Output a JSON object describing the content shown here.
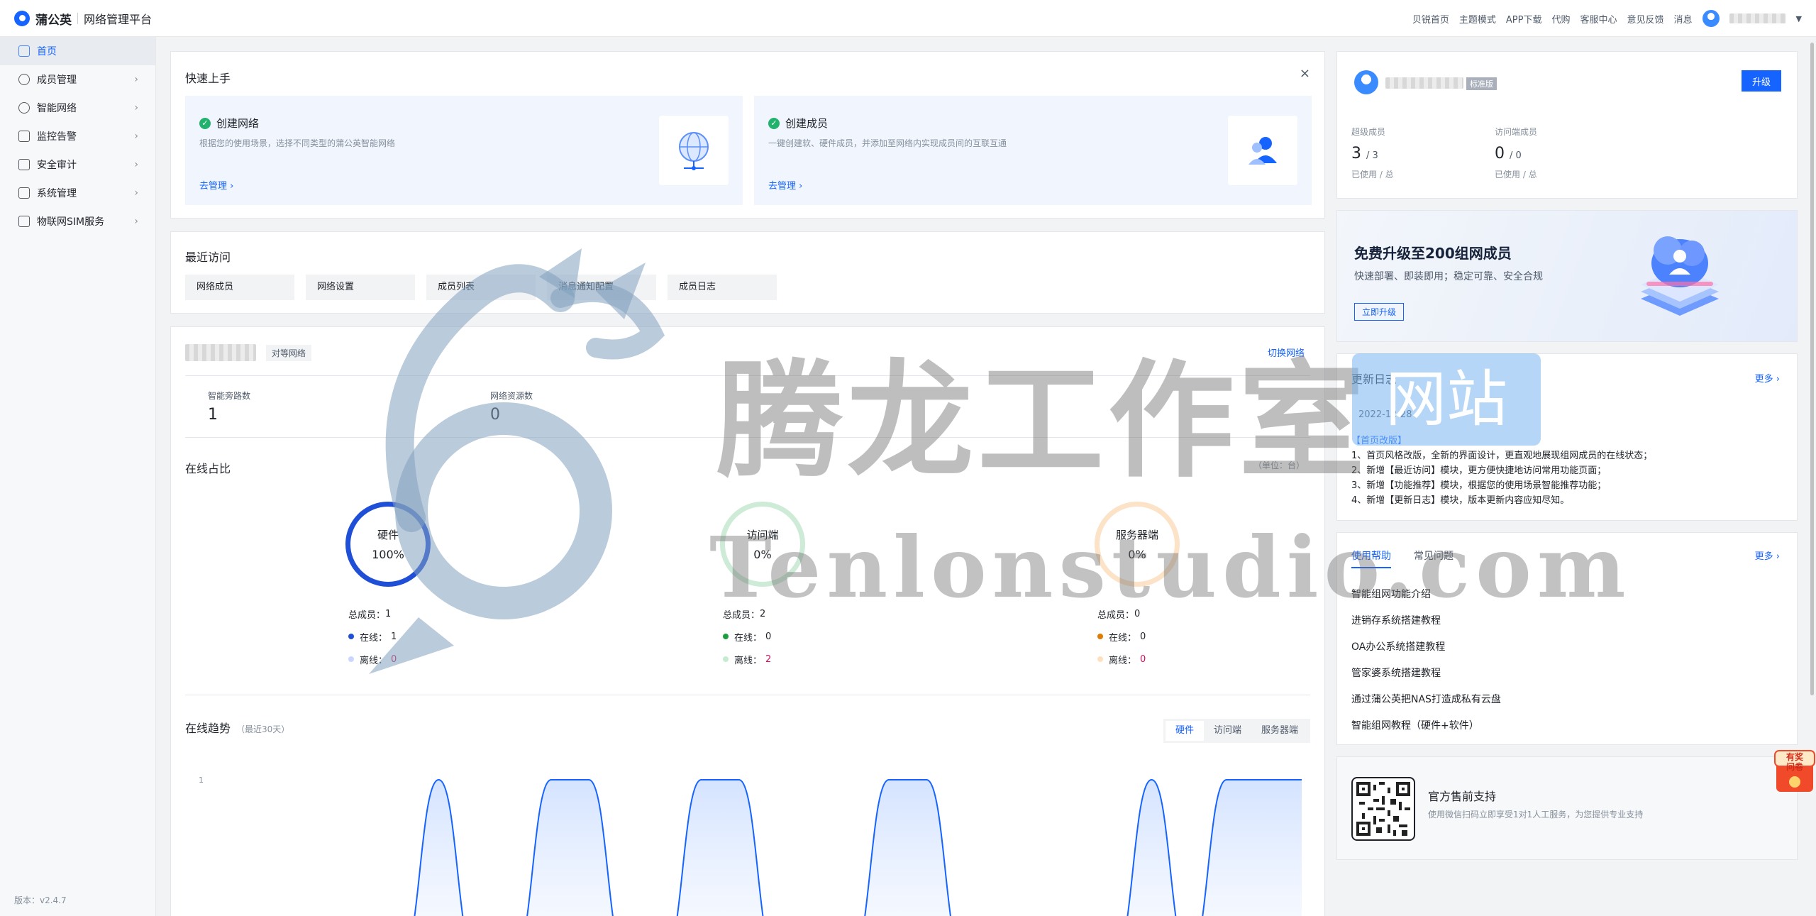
{
  "topbar": {
    "brand_name": "蒲公英",
    "brand_sub": "网络管理平台",
    "links": [
      "贝锐首页",
      "主题模式",
      "APP下载",
      "代购",
      "客服中心",
      "意见反馈",
      "消息"
    ]
  },
  "sidebar": {
    "items": [
      {
        "label": "首页",
        "icon": "home-icon",
        "active": true
      },
      {
        "label": "成员管理",
        "icon": "user-icon"
      },
      {
        "label": "智能网络",
        "icon": "network-icon"
      },
      {
        "label": "监控告警",
        "icon": "monitor-icon"
      },
      {
        "label": "安全审计",
        "icon": "audit-icon"
      },
      {
        "label": "系统管理",
        "icon": "settings-icon"
      },
      {
        "label": "物联网SIM服务",
        "icon": "sim-icon"
      }
    ],
    "version": "版本：v2.4.7"
  },
  "quick_start": {
    "title": "快速上手",
    "close": "×",
    "boxes": [
      {
        "title": "创建网络",
        "desc": "根据您的使用场景，选择不同类型的蒲公英智能网络",
        "link": "去管理"
      },
      {
        "title": "创建成员",
        "desc": "一键创建软、硬件成员，并添加至网络内实现成员间的互联互通",
        "link": "去管理"
      }
    ]
  },
  "recent": {
    "title": "最近访问",
    "items": [
      "网络成员",
      "网络设置",
      "成员列表",
      "消息通知配置",
      "成员日志"
    ]
  },
  "network": {
    "type_tag": "对等网络",
    "switch": "切换网络",
    "stats": [
      {
        "label": "智能旁路数",
        "value": "1"
      },
      {
        "label": "网络资源数",
        "value": "0"
      }
    ],
    "online_title": "在线占比",
    "unit": "（单位：台）",
    "rings": [
      {
        "label": "硬件",
        "value": "100%",
        "color": "#1f4fd6",
        "dot_on": "#1f4fd6",
        "dot_off": "#c9d6ff",
        "total_label": "总成员：",
        "total": "1",
        "online_label": "在线：",
        "online": "1",
        "offline_label": "离线：",
        "offline": "0"
      },
      {
        "label": "访问端",
        "value": "0%",
        "color": "#cdebd6",
        "dot_on": "#1a9e3f",
        "dot_off": "#c3ecd0",
        "total_label": "总成员：",
        "total": "2",
        "online_label": "在线：",
        "online": "0",
        "offline_label": "离线：",
        "offline": "2"
      },
      {
        "label": "服务器端",
        "value": "0%",
        "color": "#fce2c6",
        "dot_on": "#e07a00",
        "dot_off": "#fde1bf",
        "total_label": "总成员：",
        "total": "0",
        "online_label": "在线：",
        "online": "0",
        "offline_label": "离线：",
        "offline": "0"
      }
    ],
    "trend_title": "在线趋势",
    "trend_sub": "（最近30天）",
    "trend_tabs": [
      "硬件",
      "访问端",
      "服务器端"
    ],
    "trend_active": 0
  },
  "chart_data": {
    "type": "area",
    "title": "在线趋势",
    "subtitle": "（最近30天）",
    "ytick_labels": [
      "1"
    ],
    "ylim": [
      0,
      1
    ],
    "series": [
      {
        "color": "#1664ff",
        "values": [
          0,
          0,
          0,
          0,
          0,
          0,
          1,
          0,
          0,
          1,
          1,
          0,
          0,
          1,
          1,
          0,
          0,
          0,
          1,
          1,
          0,
          0,
          0,
          0,
          0,
          1,
          0,
          1,
          1,
          1
        ]
      }
    ]
  },
  "account": {
    "badge": "标准版",
    "upgrade": "升级",
    "quotas": [
      {
        "label": "超级成员",
        "used": "3",
        "total": "/ 3",
        "sub": "已使用 / 总"
      },
      {
        "label": "访问端成员",
        "used": "0",
        "total": "/ 0",
        "sub": "已使用 / 总"
      }
    ]
  },
  "promo": {
    "title": "免费升级至200组网成员",
    "subtitle": "快速部署、即装即用；稳定可靠、安全合规",
    "button": "立即升级"
  },
  "changelog": {
    "title": "更新日志",
    "more": "更多",
    "date": "2022-12-28",
    "lines": [
      "【首页改版】",
      "1、首页风格改版，全新的界面设计，更直观地展现组网成员的在线状态；",
      "2、新增【最近访问】模块，更方便快捷地访问常用功能页面；",
      "3、新增【功能推荐】模块，根据您的使用场景智能推荐功能；",
      "4、新增【更新日志】模块，版本更新内容应知尽知。"
    ]
  },
  "help": {
    "tabs": [
      "使用帮助",
      "常见问题"
    ],
    "more": "更多",
    "items": [
      "智能组网功能介绍",
      "进销存系统搭建教程",
      "OA办公系统搭建教程",
      "管家婆系统搭建教程",
      "通过蒲公英把NAS打造成私有云盘",
      "智能组网教程（硬件+软件）"
    ]
  },
  "support": {
    "title": "官方售前支持",
    "desc": "使用微信扫码立即享受1对1人工服务，为您提供专业支持"
  },
  "float_prize": {
    "line1": "有奖",
    "line2": "问卷"
  },
  "watermark": {
    "main": "腾龙工作室",
    "site": "网站",
    "url": "Tenlonstudio.com"
  }
}
